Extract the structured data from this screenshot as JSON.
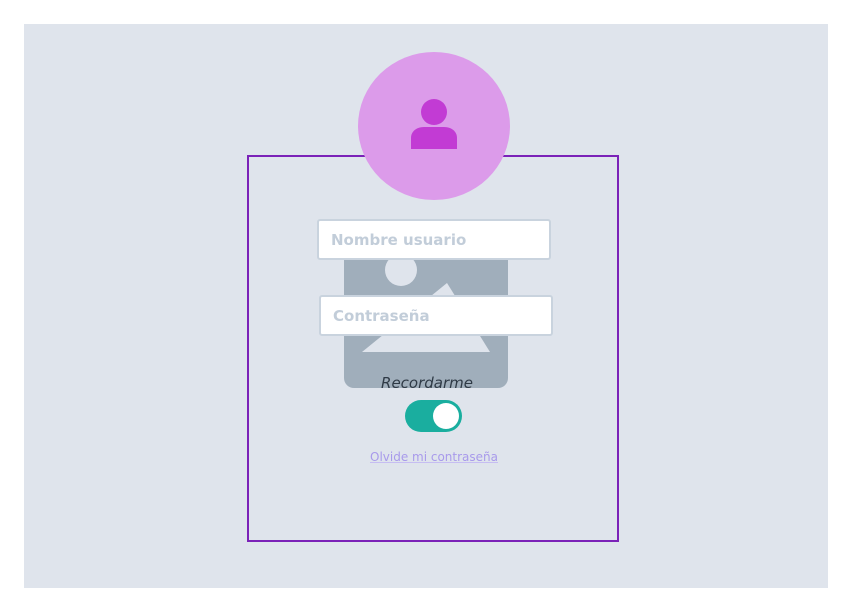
{
  "login": {
    "username_placeholder": "Nombre usuario",
    "password_placeholder": "Contraseña",
    "remember_label": "Recordarme",
    "remember_checked": true,
    "forgot_link": "Olvide mi contraseña"
  },
  "icons": {
    "avatar": "user-icon",
    "placeholder": "image-placeholder-icon"
  },
  "colors": {
    "background": "#dfe4ec",
    "frame_border": "#7b22b8",
    "avatar_bg": "#dc9bea",
    "avatar_icon": "#c23bd4",
    "placeholder_image": "#a0aebb",
    "toggle_on": "#1aae9f",
    "link": "#a89aeb",
    "input_placeholder": "#c2cdd9"
  }
}
